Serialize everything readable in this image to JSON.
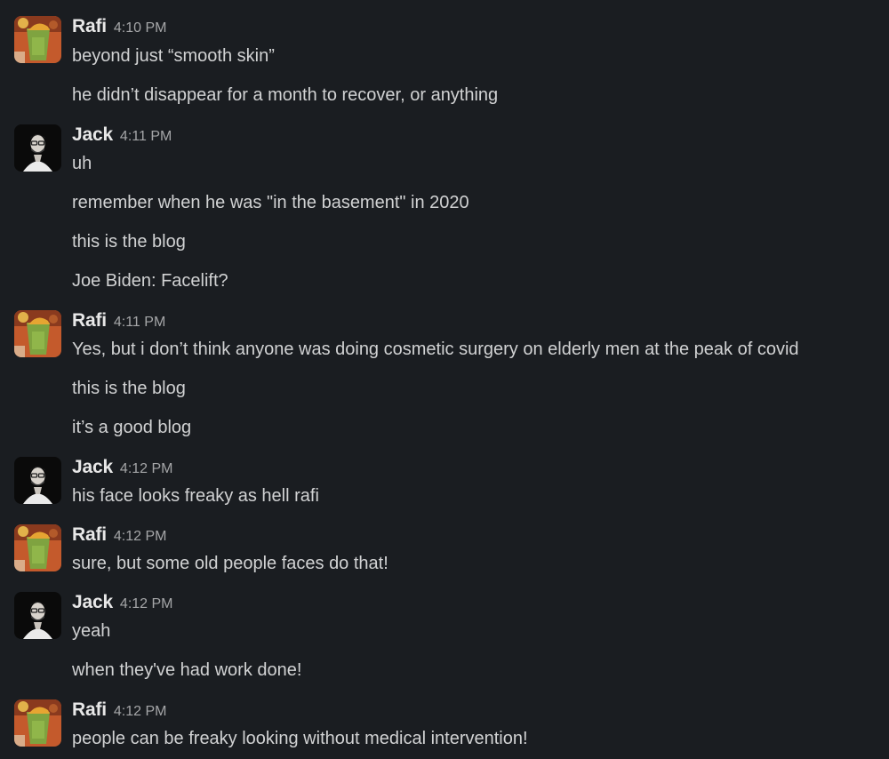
{
  "colors": {
    "background": "#1a1d21",
    "text": "#d1d2d3",
    "author": "#e8e8e8",
    "timestamp": "#a5a6a8"
  },
  "messages": [
    {
      "author": "Rafi",
      "avatar_icon": "rafi-avatar",
      "time": "4:10 PM",
      "lines": [
        "beyond just “smooth skin”",
        "he didn’t disappear for a month to recover, or anything"
      ]
    },
    {
      "author": "Jack",
      "avatar_icon": "jack-avatar",
      "time": "4:11 PM",
      "lines": [
        "uh",
        "remember when he was \"in the basement\" in 2020",
        "this is the blog",
        "Joe Biden: Facelift?"
      ]
    },
    {
      "author": "Rafi",
      "avatar_icon": "rafi-avatar",
      "time": "4:11 PM",
      "lines": [
        "Yes, but i don’t think anyone was doing cosmetic surgery on elderly men at the peak of covid",
        "this is the blog",
        "it’s a good blog"
      ]
    },
    {
      "author": "Jack",
      "avatar_icon": "jack-avatar",
      "time": "4:12 PM",
      "lines": [
        "his face looks freaky as hell rafi"
      ]
    },
    {
      "author": "Rafi",
      "avatar_icon": "rafi-avatar",
      "time": "4:12 PM",
      "lines": [
        "sure, but some old people faces do that!"
      ]
    },
    {
      "author": "Jack",
      "avatar_icon": "jack-avatar",
      "time": "4:12 PM",
      "lines": [
        "yeah",
        "when they've had work done!"
      ]
    },
    {
      "author": "Rafi",
      "avatar_icon": "rafi-avatar",
      "time": "4:12 PM",
      "lines": [
        "people can be freaky looking without medical intervention!"
      ]
    }
  ]
}
